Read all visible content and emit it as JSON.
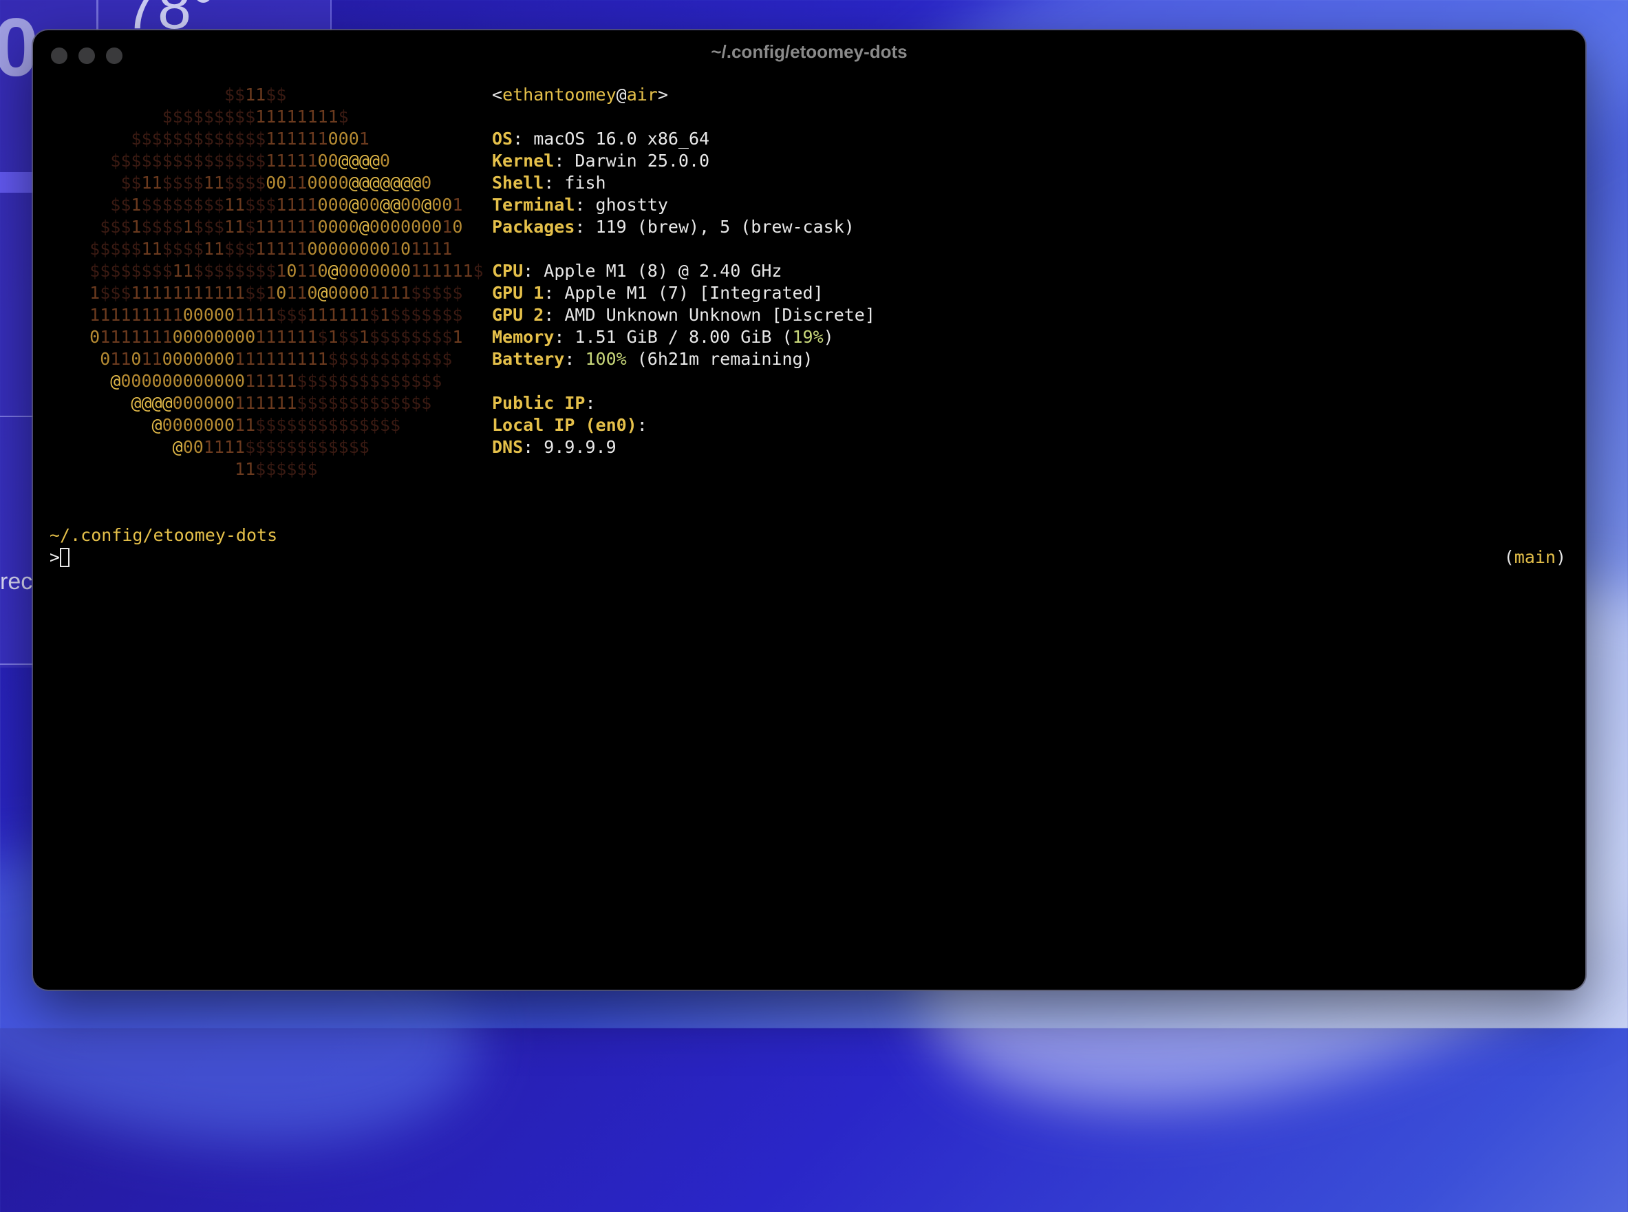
{
  "desktop": {
    "widget_big_text": "0",
    "temperature": "78°",
    "partial_text": "rec"
  },
  "window": {
    "title": "~/.config/etoomey-dots"
  },
  "ascii_art": [
    "               $$11$$",
    "         $$$$$$$$$11111111$",
    "      $$$$$$$$$$$$$1111110001",
    "    $$$$$$$$$$$$$$$1111100@@@@0",
    "     $$11$$$$11$$$$00110000@@@@@@@0",
    "    $$1$$$$$$$$11$$$1111000@00@@00@001",
    "   $$$1$$$$1$$$11$1111110000@000000010",
    "  $$$$$11$$$$11$$$1111100000000101111",
    "  $$$$$$$$11$$$$$$$$10110@0000000111111$",
    "  1$$$11111111111$$10110@00001111$$$$$",
    "  111111111000001111$$$111111$1$$$$$$$",
    "  0111111100000000111111$1$$1$$$$$$$$1",
    "   0110110000000111111111$$$$$$$$$$$$",
    "    @00000000000011111$$$$$$$$$$$$$$",
    "      @@@@000000111111$$$$$$$$$$$$$",
    "        @000000011$$$$$$$$$$$$$$",
    "          @001111$$$$$$$$$$$$",
    "                11$$$$$$"
  ],
  "fetch": {
    "user": "ethantoomey",
    "host": "air",
    "rows": [
      {
        "key": "OS",
        "value": "macOS 16.0 x86_64"
      },
      {
        "key": "Kernel",
        "value": "Darwin 25.0.0"
      },
      {
        "key": "Shell",
        "value": "fish"
      },
      {
        "key": "Terminal",
        "value": "ghostty"
      },
      {
        "key": "Packages",
        "value": "119 (brew), 5 (brew-cask)"
      },
      {
        "key": "CPU",
        "value": "Apple M1 (8) @ 2.40 GHz"
      },
      {
        "key": "GPU 1",
        "value": "Apple M1 (7) [Integrated]"
      },
      {
        "key": "GPU 2",
        "value": "AMD Unknown Unknown [Discrete]"
      },
      {
        "key": "Memory",
        "value": "1.51 GiB / 8.00 GiB (",
        "pct": "19%",
        "tail": ")"
      },
      {
        "key": "Battery",
        "value": "",
        "pct": "100%",
        "tail": " (6h21m remaining)"
      },
      {
        "key": "Public IP",
        "value": ""
      },
      {
        "key": "Local IP (en0)",
        "value": ""
      },
      {
        "key": "DNS",
        "value": "9.9.9.9"
      }
    ]
  },
  "prompt": {
    "path": "~/.config/etoomey-dots",
    "symbol": ">",
    "git_branch": "main"
  },
  "colors": {
    "accent_yellow": "#e5c04a",
    "percent_green": "#c8d77a",
    "text": "#e8e8e8",
    "ascii_dollar": "#3a1a12",
    "ascii_one": "#6b3a1e",
    "ascii_zero": "#b58a32",
    "ascii_at": "#e0b848"
  }
}
